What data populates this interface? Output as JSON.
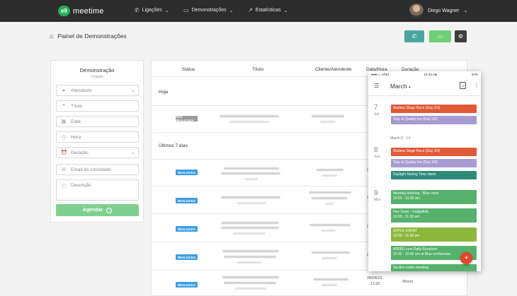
{
  "app": {
    "logo_mark": "e9",
    "logo_text": "meetime"
  },
  "nav": [
    {
      "label": "Ligações",
      "icon": "phone-icon",
      "glyph": "📞"
    },
    {
      "label": "Demonstrações",
      "icon": "monitor-icon",
      "glyph": "🖥"
    },
    {
      "label": "Estatísticas",
      "icon": "chart-icon",
      "glyph": "📈"
    }
  ],
  "user": {
    "name": "Diego Wagner"
  },
  "page": {
    "title": "Painel de Demonstrações"
  },
  "header_buttons": [
    {
      "icon": "phone-icon",
      "color": "#4aa7a0"
    },
    {
      "icon": "monitor-icon",
      "color": "#6fcf75"
    },
    {
      "icon": "user-settings-icon",
      "color": "#3c3c3c"
    }
  ],
  "form": {
    "title": "Demonstração",
    "subtitle": "Criando",
    "fields": [
      {
        "placeholder": "Atendente",
        "icon": "user-icon",
        "glyph": "👤",
        "dropdown": true
      },
      {
        "placeholder": "Título",
        "icon": "quote-icon",
        "glyph": "❝",
        "dropdown": false
      },
      {
        "placeholder": "Data",
        "icon": "calendar-icon",
        "glyph": "▦",
        "dropdown": false
      },
      {
        "placeholder": "Hora",
        "icon": "clock-icon",
        "glyph": "◷",
        "dropdown": false
      },
      {
        "placeholder": "Duração",
        "icon": "alarm-icon",
        "glyph": "⏰",
        "dropdown": true
      },
      {
        "placeholder": "Email do convidado",
        "icon": "mail-icon",
        "glyph": "✉",
        "dropdown": false
      },
      {
        "placeholder": "Descrição",
        "icon": "info-icon",
        "glyph": "ⓘ",
        "dropdown": false
      }
    ],
    "submit_label": "Agendar"
  },
  "table": {
    "headers": [
      "Status",
      "Título",
      "Cliente/Atendente",
      "Data/Hora",
      "Duração"
    ],
    "groups": [
      "Hoje",
      "Últimos 7 dias"
    ],
    "rows": [
      {
        "status": "NÃO REALIZADA",
        "status_color": "#9a9a9a",
        "date": "",
        "duration": ""
      },
      {
        "status": "REALIZADA",
        "status_color": "#3d9ee3",
        "date": "2",
        "duration": ""
      },
      {
        "status": "REALIZADA",
        "status_color": "#3d9ee3",
        "date": "2",
        "duration": ""
      },
      {
        "status": "REALIZADA",
        "status_color": "#3d9ee3",
        "date": "2",
        "duration": ""
      },
      {
        "status": "REALIZADA",
        "status_color": "#3d9ee3",
        "date": "2",
        "duration": ""
      },
      {
        "status": "REALIZADA",
        "status_color": "#3d9ee3",
        "date": "28/04/16",
        "time": "11:30",
        "duration": "45min"
      }
    ]
  },
  "phone": {
    "carrier": "●●●○○ AT&T",
    "time": "10:43 AM",
    "battery": "97%",
    "month": "March",
    "calendar_day": "10",
    "days": [
      {
        "num": "7",
        "name": "Sat"
      },
      {
        "num": "8",
        "name": "Sun"
      },
      {
        "num": "9",
        "name": "Mon"
      }
    ],
    "week_label": "March 8 - 14",
    "events": [
      {
        "title": "Madera Stage Race (Day 2/3)",
        "time": "",
        "color": "#e05a36"
      },
      {
        "title": "Stay at Quality Inn (Day 2/3)",
        "time": "",
        "color": "#a79bd2"
      },
      {
        "title": "Madera Stage Race (Day 3/3)",
        "time": "",
        "color": "#e05a36"
      },
      {
        "title": "Stay at Quality Inn (Day 3/3)",
        "time": "",
        "color": "#a79bd2"
      },
      {
        "title": "Daylight Saving Time starts",
        "time": "",
        "color": "#2e8b78"
      },
      {
        "title": "Morning meeting - Blue room",
        "time": "10:00 - 10:30 am",
        "color": "#56b16c"
      },
      {
        "title": "Dev Team - Gadgetlab",
        "time": "10:00 - 11:30 am",
        "color": "#56b16c"
      },
      {
        "title": "APPLE EVENT",
        "time": "10:00 - 11:30 am",
        "color": "#8bb83a"
      },
      {
        "title": "WIRED.com Daily Rundown",
        "time": "10:30 - 10:45 am at Blue conference",
        "color": "#56b16c"
      },
      {
        "title": "Section editor meeting",
        "time": "",
        "color": "#56b16c"
      }
    ],
    "fab_label": "+"
  }
}
